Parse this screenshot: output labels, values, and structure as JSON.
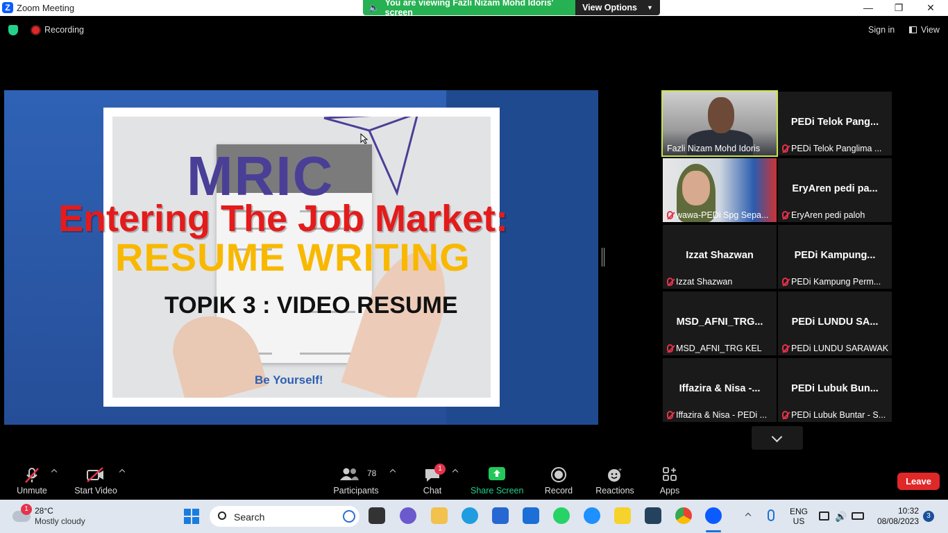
{
  "window": {
    "title": "Zoom Meeting",
    "logo_letter": "Z"
  },
  "share_banner": {
    "message": "You are viewing Fazli Nizam Mohd Idoris' screen",
    "view_options_label": "View Options"
  },
  "topbar": {
    "recording_label": "Recording",
    "signin_label": "Sign in",
    "view_label": "View"
  },
  "slide": {
    "logo_text": "MRIC",
    "title_line1": "Entering The Job Market:",
    "title_line2": "RESUME WRITING",
    "subtitle": "TOPIK 3 : VIDEO RESUME",
    "tagline": "Be Yourself!"
  },
  "gallery": {
    "tiles": [
      {
        "display_name": "",
        "label": "Fazli Nizam Mohd Idoris",
        "has_video": true,
        "muted": false,
        "active_speaker": true
      },
      {
        "display_name": "PEDi Telok Pang...",
        "label": "PEDi Telok Panglima ...",
        "has_video": false,
        "muted": true
      },
      {
        "display_name": "",
        "label": "wawa-PEDi Spg Sepa...",
        "has_video": true,
        "muted": true
      },
      {
        "display_name": "EryAren pedi pa...",
        "label": "EryAren pedi paloh",
        "has_video": false,
        "muted": true
      },
      {
        "display_name": "Izzat Shazwan",
        "label": "Izzat Shazwan",
        "has_video": false,
        "muted": true
      },
      {
        "display_name": "PEDi  Kampung...",
        "label": "PEDi Kampung Perm...",
        "has_video": false,
        "muted": true
      },
      {
        "display_name": "MSD_AFNI_TRG...",
        "label": "MSD_AFNI_TRG KEL",
        "has_video": false,
        "muted": true
      },
      {
        "display_name": "PEDi LUNDU SA...",
        "label": "PEDi LUNDU SARAWAK",
        "has_video": false,
        "muted": true
      },
      {
        "display_name": "Iffazira & Nisa -...",
        "label": "Iffazira & Nisa - PEDi ...",
        "has_video": false,
        "muted": true
      },
      {
        "display_name": "PEDi Lubuk Bun...",
        "label": "PEDi Lubuk Buntar - S...",
        "has_video": false,
        "muted": true
      }
    ]
  },
  "toolbar": {
    "unmute_label": "Unmute",
    "start_video_label": "Start Video",
    "participants_label": "Participants",
    "participants_count": "78",
    "chat_label": "Chat",
    "chat_badge": "1",
    "share_screen_label": "Share Screen",
    "record_label": "Record",
    "reactions_label": "Reactions",
    "apps_label": "Apps",
    "leave_label": "Leave"
  },
  "taskbar": {
    "weather_badge": "1",
    "weather_temp": "28°C",
    "weather_desc": "Mostly cloudy",
    "search_placeholder": "Search",
    "lang_line1": "ENG",
    "lang_line2": "US",
    "time": "10:32",
    "date": "08/08/2023",
    "notification_count": "3"
  },
  "colors": {
    "zoom_blue": "#0b5cff",
    "share_green": "#26b152",
    "leave_red": "#e02828",
    "active_speaker_outline": "#c8e64b",
    "slide_title_red": "#e41b1b",
    "slide_title_yellow": "#f9b800"
  }
}
